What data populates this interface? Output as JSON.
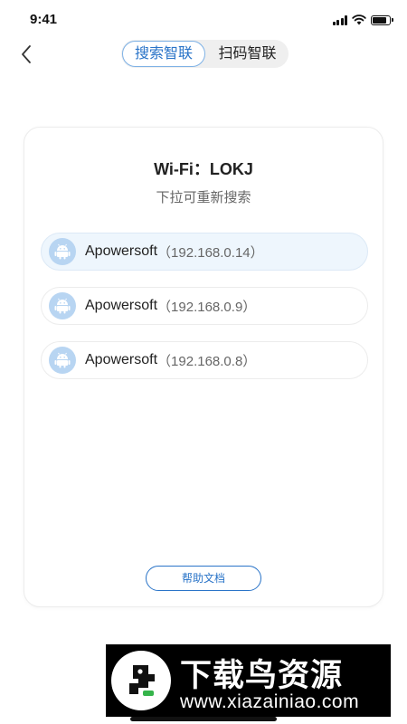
{
  "status_bar": {
    "time": "9:41"
  },
  "header": {
    "tabs": [
      {
        "label": "搜索智联",
        "active": true
      },
      {
        "label": "扫码智联",
        "active": false
      }
    ]
  },
  "card": {
    "wifi_title": "Wi-Fi：LOKJ",
    "pull_hint": "下拉可重新搜索",
    "devices": [
      {
        "name": "Apowersoft",
        "ip": "（192.168.0.14）",
        "selected": true
      },
      {
        "name": "Apowersoft",
        "ip": "（192.168.0.9）",
        "selected": false
      },
      {
        "name": "Apowersoft",
        "ip": "（192.168.0.8）",
        "selected": false
      }
    ],
    "help_label": "帮助文档"
  },
  "watermark": {
    "title": "下载鸟资源",
    "url": "www.xiazainiao.com"
  },
  "colors": {
    "accent": "#2a74c8",
    "selected_row": "#eef6fd",
    "device_icon_bg": "#b8d5f2"
  }
}
